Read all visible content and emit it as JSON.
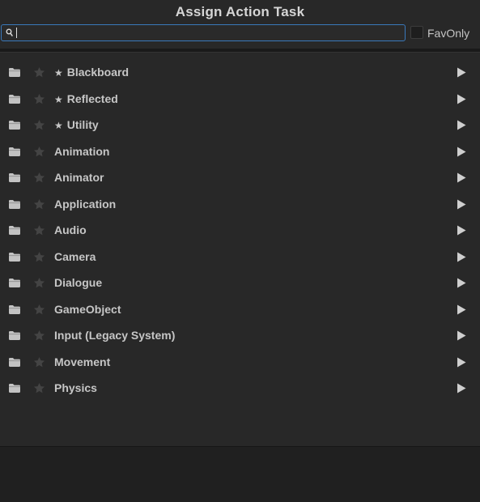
{
  "window": {
    "title": "Assign Action Task"
  },
  "search": {
    "value": "",
    "placeholder": ""
  },
  "fav_only": {
    "label": "FavOnly",
    "checked": false
  },
  "items": [
    {
      "prefix": "★",
      "label": "Blackboard"
    },
    {
      "prefix": "★",
      "label": "Reflected"
    },
    {
      "prefix": "★",
      "label": "Utility"
    },
    {
      "prefix": "",
      "label": "Animation"
    },
    {
      "prefix": "",
      "label": "Animator"
    },
    {
      "prefix": "",
      "label": "Application"
    },
    {
      "prefix": "",
      "label": "Audio"
    },
    {
      "prefix": "",
      "label": "Camera"
    },
    {
      "prefix": "",
      "label": "Dialogue"
    },
    {
      "prefix": "",
      "label": "GameObject"
    },
    {
      "prefix": "",
      "label": "Input (Legacy System)"
    },
    {
      "prefix": "",
      "label": "Movement"
    },
    {
      "prefix": "",
      "label": "Physics"
    }
  ],
  "icons": {
    "row_folder": "folder-icon",
    "row_favorite": "star-icon",
    "row_expand": "play-arrow-icon",
    "search": "search-icon"
  },
  "colors": {
    "background": "#282828",
    "focus_border": "#3a79bb",
    "text": "#c6c6c6"
  }
}
